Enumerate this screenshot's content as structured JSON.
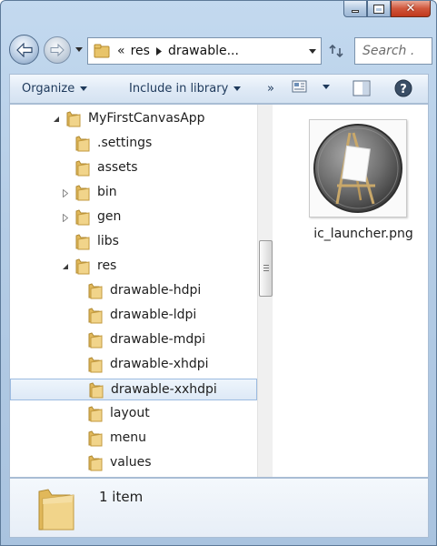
{
  "window": {
    "caption_icons": [
      "minimize-icon",
      "maximize-icon",
      "close-icon"
    ]
  },
  "address_bar": {
    "overflow_marker": "«",
    "crumbs": [
      "res",
      "drawable..."
    ],
    "search_placeholder": "Search ..."
  },
  "toolbar": {
    "organize_label": "Organize",
    "include_label": "Include in library",
    "more_label": "»"
  },
  "tree": {
    "items": [
      {
        "label": "MyFirstCanvasApp",
        "level": 0,
        "expander": "expanded"
      },
      {
        "label": ".settings",
        "level": 1,
        "expander": "none"
      },
      {
        "label": "assets",
        "level": 1,
        "expander": "none"
      },
      {
        "label": "bin",
        "level": 1,
        "expander": "collapsed"
      },
      {
        "label": "gen",
        "level": 1,
        "expander": "collapsed"
      },
      {
        "label": "libs",
        "level": 1,
        "expander": "none"
      },
      {
        "label": "res",
        "level": 1,
        "expander": "expanded"
      },
      {
        "label": "drawable-hdpi",
        "level": 2,
        "expander": "none"
      },
      {
        "label": "drawable-ldpi",
        "level": 2,
        "expander": "none"
      },
      {
        "label": "drawable-mdpi",
        "level": 2,
        "expander": "none"
      },
      {
        "label": "drawable-xhdpi",
        "level": 2,
        "expander": "none"
      },
      {
        "label": "drawable-xxhdpi",
        "level": 2,
        "expander": "none",
        "selected": true
      },
      {
        "label": "layout",
        "level": 2,
        "expander": "none"
      },
      {
        "label": "menu",
        "level": 2,
        "expander": "none"
      },
      {
        "label": "values",
        "level": 2,
        "expander": "none"
      }
    ]
  },
  "files": [
    {
      "name": "ic_launcher.png",
      "icon": "launcher-easel-icon"
    }
  ],
  "details": {
    "item_count": "1 item"
  },
  "colors": {
    "frame": "#b5cde6",
    "selection": "#dde9f6",
    "folder": "#e8c46a"
  }
}
